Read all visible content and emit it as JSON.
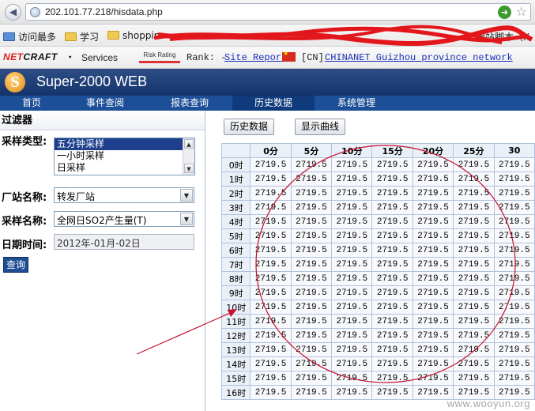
{
  "browser": {
    "url": "202.101.77.218/hisdata.php",
    "bookmarks": [
      "访问最多",
      "学习",
      "shoppin"
    ],
    "bookmark_right": "跨站脚本（X",
    "netcraft": {
      "logo_part1": "NET",
      "logo_part2": "CRAFT",
      "services": "Services",
      "risk_label": "Risk Rating",
      "rank_label": "Rank: -",
      "site_report": "Site Report",
      "country": "[CN]",
      "network": "CHINANET Guizhou province network"
    }
  },
  "app": {
    "logo_letter": "S",
    "title": "Super-2000 WEB",
    "nav": [
      "首页",
      "事件查阅",
      "报表查询",
      "历史数据",
      "系统管理"
    ]
  },
  "filter": {
    "header": "过滤器",
    "sample_type_label": "采样类型:",
    "sample_type_options": [
      "五分钟采样",
      "一小时采样",
      "日采样"
    ],
    "station_label": "厂站名称:",
    "station_value": "转发厂站",
    "sample_name_label": "采样名称:",
    "sample_name_value": "全网日SO2产生量(T)",
    "date_label": "日期时间:",
    "date_value": "2012年-01月-02日",
    "query_button": "查询"
  },
  "toolbar": {
    "history_button": "历史数据",
    "curve_button": "显示曲线"
  },
  "table": {
    "columns": [
      "0分",
      "5分",
      "10分",
      "15分",
      "20分",
      "25分",
      "30"
    ],
    "rows": [
      "0时",
      "1时",
      "2时",
      "3时",
      "4时",
      "5时",
      "6时",
      "7时",
      "8时",
      "9时",
      "10时",
      "11时",
      "12时",
      "13时",
      "14时",
      "15时",
      "16时"
    ],
    "cell_value": "2719.5"
  },
  "watermark": "www.wooyun.org",
  "colors": {
    "header_bg": "#1c3f7a",
    "nav_bg": "#1c4f98",
    "annotation": "#c8102e"
  }
}
